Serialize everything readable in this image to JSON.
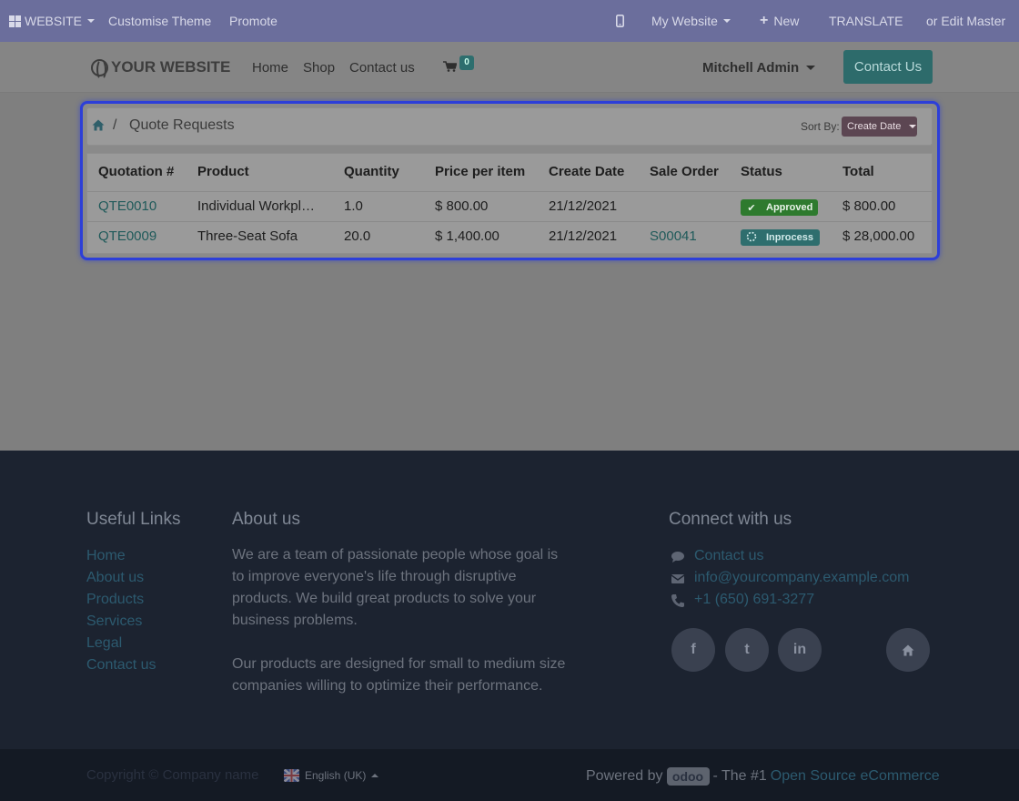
{
  "admin_bar": {
    "website_menu": "WEBSITE",
    "customise": "Customise Theme",
    "promote": "Promote",
    "my_website": "My Website",
    "new": "New",
    "translate": "TRANSLATE",
    "edit_master": "or Edit Master"
  },
  "header": {
    "logo": "YOUR WEBSITE",
    "nav": [
      "Home",
      "Shop",
      "Contact us"
    ],
    "cart_count": "0",
    "user": "Mitchell Admin",
    "contact_button": "Contact Us"
  },
  "breadcrumb": {
    "separator": "/",
    "current": "Quote Requests"
  },
  "sort": {
    "label": "Sort By:",
    "value": "Create Date"
  },
  "table": {
    "headers": [
      "Quotation #",
      "Product",
      "Quantity",
      "Price per item",
      "Create Date",
      "Sale Order",
      "Status",
      "Total"
    ],
    "rows": [
      {
        "quotation": "QTE0010",
        "product": "Individual Workpl…",
        "quantity": "1.0",
        "price": "$ 800.00",
        "date": "21/12/2021",
        "sale_order": "",
        "status": "Approved",
        "total": "$ 800.00"
      },
      {
        "quotation": "QTE0009",
        "product": "Three-Seat Sofa",
        "quantity": "20.0",
        "price": "$ 1,400.00",
        "date": "21/12/2021",
        "sale_order": "S00041",
        "status": "Inprocess",
        "total": "$ 28,000.00"
      }
    ]
  },
  "footer": {
    "useful_links_title": "Useful Links",
    "useful_links": [
      "Home",
      "About us",
      "Products",
      "Services",
      "Legal",
      "Contact us"
    ],
    "about_title": "About us",
    "about_p1": [
      "We are a team of passionate people whose goal is",
      "to improve everyone's life through disruptive",
      "products. We build great products to solve your",
      "business problems."
    ],
    "about_p2": [
      "Our products are designed for small to medium size",
      "companies willing to optimize their performance."
    ],
    "connect_title": "Connect with us",
    "contact_link": "Contact us",
    "email": "info@yourcompany.example.com",
    "phone": "+1 (650) 691-3277",
    "social": [
      "f",
      "t",
      "in"
    ],
    "copyright": "Copyright © Company name",
    "language": "English (UK)",
    "powered_by": "Powered by",
    "odoo": "odoo",
    "the_1": "- The #1",
    "ecommerce_link": "Open Source eCommerce"
  }
}
